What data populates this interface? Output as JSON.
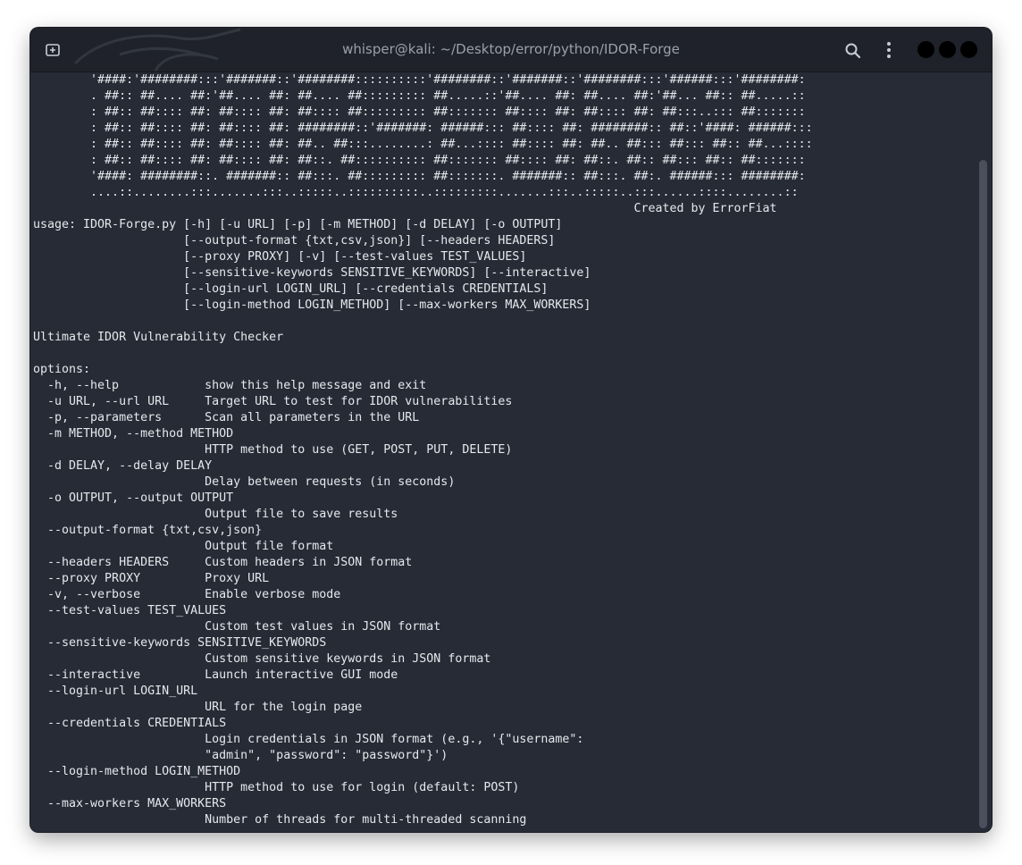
{
  "window": {
    "title": "whisper@kali: ~/Desktop/error/python/IDOR-Forge"
  },
  "icons": {
    "new_tab": "new-tab-icon",
    "search": "search-icon",
    "menu": "kebab-menu-icon",
    "minimize": "minimize-button",
    "maximize": "maximize-button",
    "close": "close-button"
  },
  "colors": {
    "terminal_bg": "#272b36",
    "titlebar_bg": "#1f222a",
    "text": "#e6e8ec",
    "title_text": "#9aa0ab"
  },
  "terminal": {
    "banner": [
      "        '####:'########:::'#######::'########::::::::::'########::'#######::'########:::'######:::'########:",
      "        . ##:: ##.... ##:'##.... ##: ##.... ##::::::::: ##.....::'##.... ##: ##.... ##:'##... ##:: ##.....::",
      "        : ##:: ##:::: ##: ##:::: ##: ##:::: ##::::::::: ##::::::: ##:::: ##: ##:::: ##: ##:::..::: ##:::::::",
      "        : ##:: ##:::: ##: ##:::: ##: ########::'#######: ######::: ##:::: ##: ########:: ##::'####: ######:::",
      "        : ##:: ##:::: ##: ##:::: ##: ##.. ##:::........: ##...:::: ##:::: ##: ##.. ##::: ##::: ##:: ##...::::",
      "        : ##:: ##:::: ##: ##:::: ##: ##::. ##:::::::::: ##::::::: ##:::: ##: ##::. ##:: ##::: ##:: ##:::::::",
      "        '####: ########::. #######:: ##:::. ##::::::::: ##:::::::. #######:: ##:::. ##:. ######::: ########:",
      "        ....::........:::.......:::..:::::..::::::::::..:::::::::.......:::..:::::..:::......::::........::",
      "                                                                                    Created by ErrorFiat"
    ],
    "usage": [
      "usage: IDOR-Forge.py [-h] [-u URL] [-p] [-m METHOD] [-d DELAY] [-o OUTPUT]",
      "                     [--output-format {txt,csv,json}] [--headers HEADERS]",
      "                     [--proxy PROXY] [-v] [--test-values TEST_VALUES]",
      "                     [--sensitive-keywords SENSITIVE_KEYWORDS] [--interactive]",
      "                     [--login-url LOGIN_URL] [--credentials CREDENTIALS]",
      "                     [--login-method LOGIN_METHOD] [--max-workers MAX_WORKERS]"
    ],
    "description": "Ultimate IDOR Vulnerability Checker",
    "options_header": "options:",
    "options": [
      "  -h, --help            show this help message and exit",
      "  -u URL, --url URL     Target URL to test for IDOR vulnerabilities",
      "  -p, --parameters      Scan all parameters in the URL",
      "  -m METHOD, --method METHOD",
      "                        HTTP method to use (GET, POST, PUT, DELETE)",
      "  -d DELAY, --delay DELAY",
      "                        Delay between requests (in seconds)",
      "  -o OUTPUT, --output OUTPUT",
      "                        Output file to save results",
      "  --output-format {txt,csv,json}",
      "                        Output file format",
      "  --headers HEADERS     Custom headers in JSON format",
      "  --proxy PROXY         Proxy URL",
      "  -v, --verbose         Enable verbose mode",
      "  --test-values TEST_VALUES",
      "                        Custom test values in JSON format",
      "  --sensitive-keywords SENSITIVE_KEYWORDS",
      "                        Custom sensitive keywords in JSON format",
      "  --interactive         Launch interactive GUI mode",
      "  --login-url LOGIN_URL",
      "                        URL for the login page",
      "  --credentials CREDENTIALS",
      "                        Login credentials in JSON format (e.g., '{\"username\":",
      "                        \"admin\", \"password\": \"password\"}')",
      "  --login-method LOGIN_METHOD",
      "                        HTTP method to use for login (default: POST)",
      "  --max-workers MAX_WORKERS",
      "                        Number of threads for multi-threaded scanning"
    ]
  }
}
